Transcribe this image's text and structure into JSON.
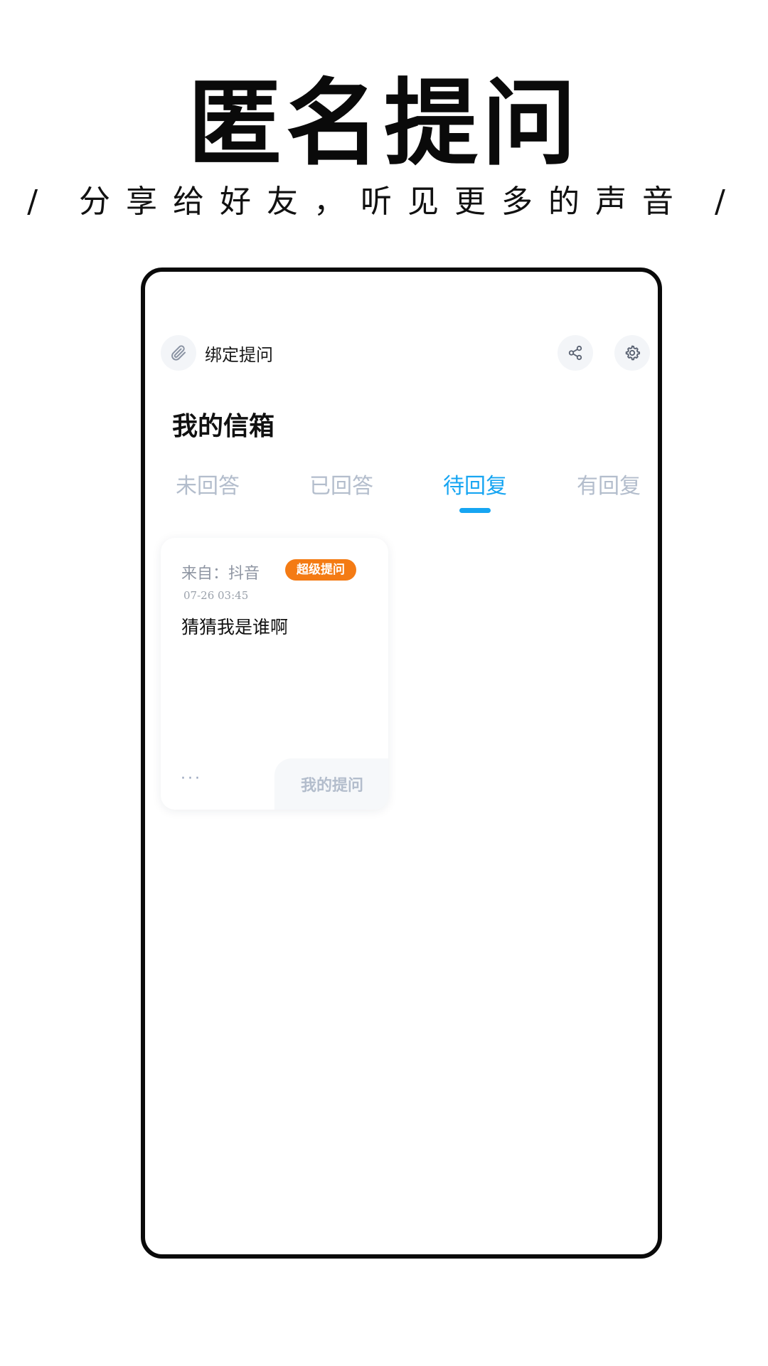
{
  "hero": {
    "title": "匿名提问",
    "subtitle": "/ 分享给好友，听见更多的声音 /"
  },
  "topbar": {
    "bind_label": "绑定提问",
    "icons": [
      "paperclip-icon",
      "share-icon",
      "gear-icon"
    ]
  },
  "inbox": {
    "title": "我的信箱",
    "tabs": [
      {
        "label": "未回答",
        "active": false
      },
      {
        "label": "已回答",
        "active": false
      },
      {
        "label": "待回复",
        "active": true
      },
      {
        "label": "有回复",
        "active": false
      }
    ]
  },
  "card": {
    "source": "来自：抖音",
    "badge": "超级提问",
    "time": "07-26 03:45",
    "question": "猜猜我是谁啊",
    "more": "···",
    "my_question_label": "我的提问"
  },
  "colors": {
    "accent": "#16a5f2",
    "badge": "#f47b14",
    "inactive_tab": "#b3bdcc"
  }
}
